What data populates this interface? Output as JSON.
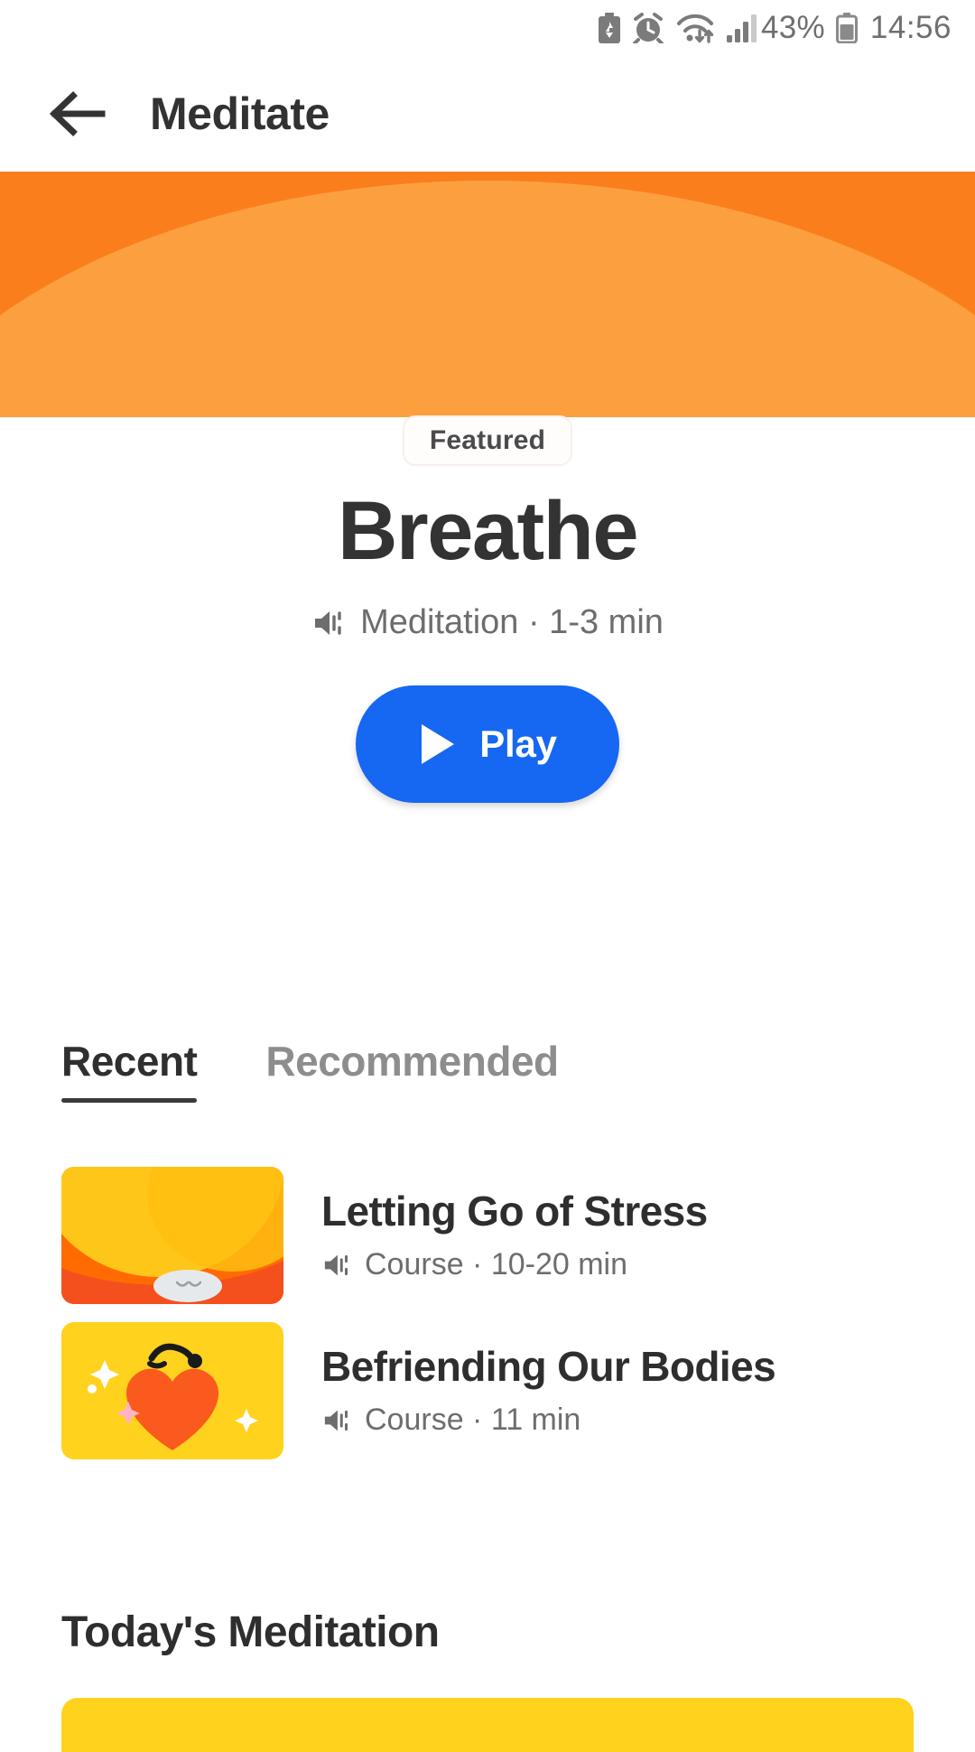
{
  "status_bar": {
    "battery_saver_icon": "battery-saver-icon",
    "alarm_icon": "alarm-icon",
    "wifi_icon": "wifi-icon",
    "signal_icon": "cellular-signal-icon",
    "battery_percent": "43%",
    "battery_icon": "battery-icon",
    "time": "14:56"
  },
  "header": {
    "back_icon": "arrow-left-icon",
    "title": "Meditate"
  },
  "hero": {
    "banner_color_outer": "#fb7e1c",
    "banner_color_inner": "#fca03f",
    "badge": "Featured",
    "title": "Breathe",
    "speaker_icon": "volume-icon",
    "meta": "Meditation · 1-3 min",
    "play_button": {
      "label": "Play",
      "icon": "play-icon",
      "color": "#1667f2"
    }
  },
  "tabs": [
    {
      "label": "Recent",
      "active": true
    },
    {
      "label": "Recommended",
      "active": false
    }
  ],
  "list": [
    {
      "title": "Letting Go of Stress",
      "speaker_icon": "volume-icon",
      "meta": "Course · 10-20 min",
      "thumb_colors": {
        "bg": "#ff6b00",
        "shape": "#ffc61a",
        "accent": "#f4501e"
      }
    },
    {
      "title": "Befriending Our Bodies",
      "speaker_icon": "volume-icon",
      "meta": "Course · 11 min",
      "thumb_colors": {
        "bg": "#ffd21e",
        "shape": "#fa5a1e",
        "accent": "#ffffff"
      }
    }
  ],
  "section": {
    "title": "Today's Meditation"
  }
}
